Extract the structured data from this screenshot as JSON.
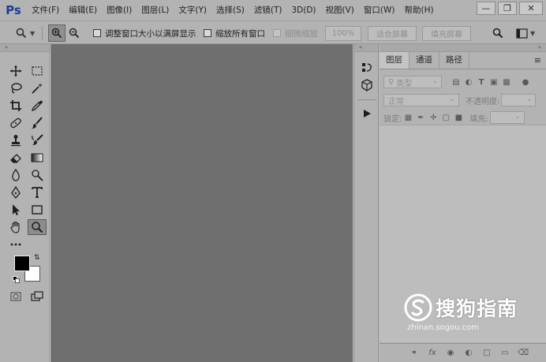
{
  "app": {
    "logo": "Ps"
  },
  "menu": [
    "文件(F)",
    "编辑(E)",
    "图像(I)",
    "图层(L)",
    "文字(Y)",
    "选择(S)",
    "滤镜(T)",
    "3D(D)",
    "视图(V)",
    "窗口(W)",
    "帮助(H)"
  ],
  "window_controls": {
    "minimize": "—",
    "restore": "❐",
    "close": "✕"
  },
  "options": {
    "resize_windows_label": "调整窗口大小以满屏显示",
    "zoom_all_label": "缩放所有窗口",
    "scrubby_zoom_label": "细微缩放",
    "zoom_percent": "100%",
    "fit_screen_label": "适合屏幕",
    "fill_screen_label": "填充屏幕"
  },
  "panel": {
    "tabs": [
      "图层",
      "通道",
      "路径"
    ],
    "filter_kind": "类型",
    "blend_mode": "正常",
    "opacity_label": "不透明度:",
    "lock_label": "锁定:",
    "fill_label": "填充:"
  },
  "watermark": {
    "text": "搜狗指南",
    "url": "zhinan.sogou.com"
  },
  "colors": {
    "foreground": "#000000",
    "background": "#ffffff",
    "logo": "#1c3c9a"
  }
}
